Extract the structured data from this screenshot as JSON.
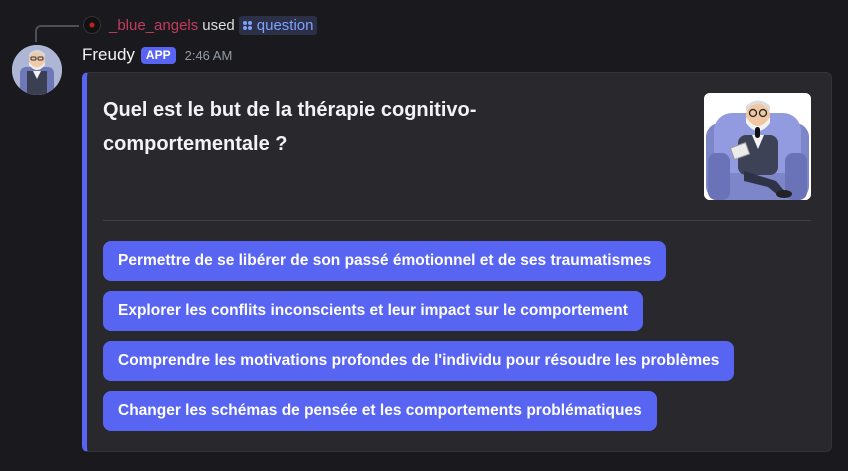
{
  "interaction": {
    "user": "_blue_angels",
    "used_text": "used",
    "command": "question"
  },
  "message": {
    "author": "Freudy",
    "badge": "APP",
    "timestamp": "2:46 AM"
  },
  "embed": {
    "accent_color": "#5865f2",
    "title": "Quel est le but de la thérapie cognitivo-comportementale ?",
    "thumbnail_icon": "freud-psychologist-illustration"
  },
  "answers": [
    "Permettre de se libérer de son passé émotionnel et de ses traumatismes",
    "Explorer les conflits inconscients et leur impact sur le comportement",
    "Comprendre les motivations profondes de l'individu pour résoudre les problèmes",
    "Changer les schémas de pensée et les comportements problématiques"
  ]
}
